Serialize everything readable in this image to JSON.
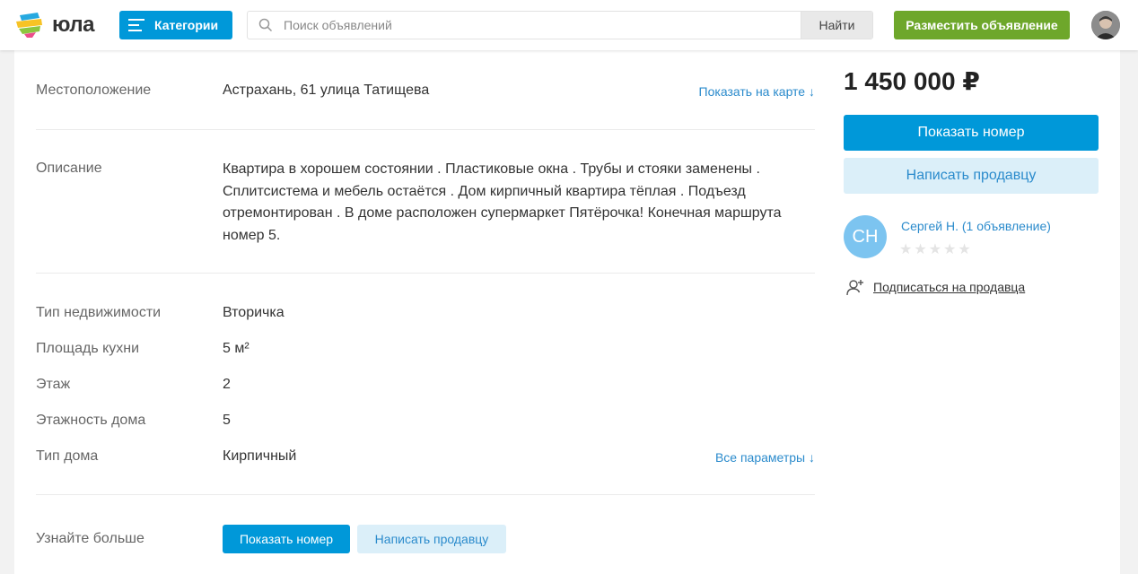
{
  "header": {
    "logo_text": "юла",
    "categories_label": "Категории",
    "search_placeholder": "Поиск объявлений",
    "search_button": "Найти",
    "post_button": "Разместить объявление"
  },
  "location": {
    "label": "Местоположение",
    "value": "Астрахань, 61 улица Татищева",
    "map_link": "Показать на карте ↓"
  },
  "description": {
    "label": "Описание",
    "text": "Квартира в хорошем состоянии . Пластиковые окна . Трубы и стояки заменены . Сплитсистема и мебель остаётся . Дом кирпичный квартира тёплая . Подъезд отремонтирован . В доме расположен супермаркет Пятёрочка! Конечная маршрута номер 5."
  },
  "params": [
    {
      "label": "Тип недвижимости",
      "value": "Вторичка"
    },
    {
      "label": "Площадь кухни",
      "value": "5 м²"
    },
    {
      "label": "Этаж",
      "value": "2"
    },
    {
      "label": "Этажность дома",
      "value": "5"
    },
    {
      "label": "Тип дома",
      "value": "Кирпичный"
    }
  ],
  "all_params_link": "Все параметры ↓",
  "learn_more": {
    "label": "Узнайте больше",
    "show_number": "Показать номер",
    "write_seller": "Написать продавцу"
  },
  "sidebar": {
    "price": "1 450 000 ₽",
    "show_number": "Показать номер",
    "write_seller": "Написать продавцу",
    "seller_initials": "СН",
    "seller_name": "Сергей Н. (1 объявление)",
    "rating_stars": 0,
    "subscribe": "Подписаться на продавца"
  },
  "colors": {
    "accent_blue": "#0098d9",
    "accent_green": "#6ea72b",
    "link_blue": "#2b8bcc"
  }
}
